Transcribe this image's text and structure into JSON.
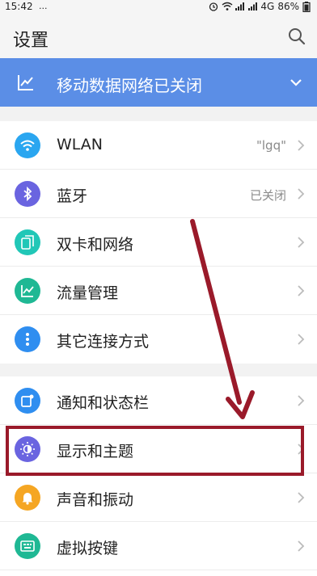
{
  "status_bar": {
    "time": "15:42",
    "extra": "...",
    "network": "4G",
    "battery": "86%"
  },
  "header": {
    "title": "设置"
  },
  "banner": {
    "text": "移动数据网络已关闭"
  },
  "groups": [
    {
      "items": [
        {
          "label": "WLAN",
          "value": "\"lgq\"",
          "icon": "wifi-icon",
          "color": "#2aa6f0"
        },
        {
          "label": "蓝牙",
          "value": "已关闭",
          "icon": "bluetooth-icon",
          "color": "#6a64e0"
        },
        {
          "label": "双卡和网络",
          "value": "",
          "icon": "sim-cards-icon",
          "color": "#21c7b7"
        },
        {
          "label": "流量管理",
          "value": "",
          "icon": "data-usage-icon",
          "color": "#1fb894"
        },
        {
          "label": "其它连接方式",
          "value": "",
          "icon": "more-dots-icon",
          "color": "#2f8ef0"
        }
      ]
    },
    {
      "items": [
        {
          "label": "通知和状态栏",
          "value": "",
          "icon": "notification-icon",
          "color": "#2f8ef0"
        },
        {
          "label": "显示和主题",
          "value": "",
          "icon": "display-theme-icon",
          "color": "#6a64e0"
        },
        {
          "label": "声音和振动",
          "value": "",
          "icon": "bell-icon",
          "color": "#f5a623"
        },
        {
          "label": "虚拟按键",
          "value": "",
          "icon": "virtual-keys-icon",
          "color": "#1fb894"
        }
      ]
    }
  ],
  "annotation": {
    "color": "#9a1a2a",
    "highlighted_item": "显示和主题"
  }
}
